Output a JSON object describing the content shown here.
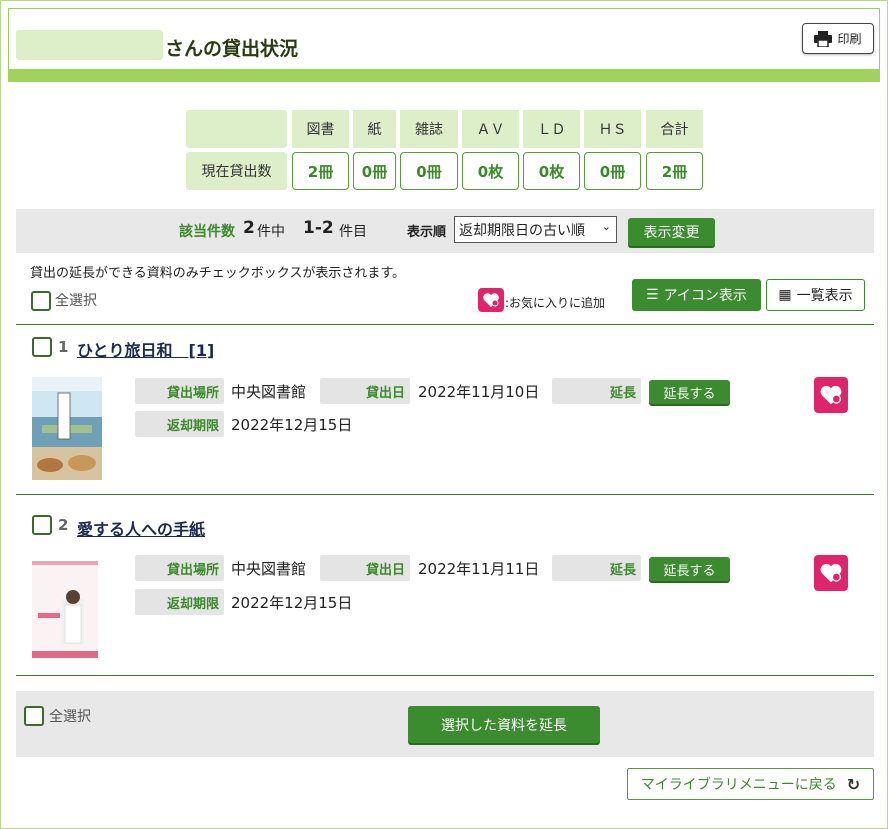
{
  "header": {
    "title_suffix": "さんの貸出状況",
    "print_label": "印刷"
  },
  "stats": {
    "headers": [
      "図書",
      "紙",
      "雑誌",
      "ＡＶ",
      "ＬＤ",
      "ＨＳ",
      "合計"
    ],
    "row_label": "現在貸出数",
    "values": [
      "2冊",
      "0冊",
      "0冊",
      "0枚",
      "0枚",
      "0冊",
      "2冊"
    ]
  },
  "result": {
    "count_label": "該当件数",
    "total": "2",
    "total_unit": "件中",
    "range": "1-2",
    "range_unit": "件目",
    "sort_label": "表示順",
    "sort_selected": "返却期限日の古い順",
    "change_button": "表示変更"
  },
  "note": "貸出の延長ができる資料のみチェックボックスが表示されます。",
  "select_all": "全選択",
  "favorite_legend": ":お気に入りに追加",
  "view_buttons": {
    "icon": "アイコン表示",
    "list": "一覧表示"
  },
  "field_labels": {
    "location": "貸出場所",
    "loan_date": "貸出日",
    "extend": "延長",
    "due": "返却期限",
    "extend_button": "延長する"
  },
  "items": [
    {
      "no": "1",
      "title": "ひとり旅日和　[1]",
      "location": "中央図書館",
      "loan_date": "2022年11月10日",
      "due": "2022年12月15日"
    },
    {
      "no": "2",
      "title": "愛する人への手紙",
      "location": "中央図書館",
      "loan_date": "2022年11月11日",
      "due": "2022年12月15日"
    }
  ],
  "bottom": {
    "extend_selected": "選択した資料を延長",
    "back": "マイライブラリメニューに戻る"
  },
  "colors": {
    "accent_green": "#3b8c2e",
    "header_bar": "#9fd35c",
    "favorite_pink": "#e0246c"
  },
  "icons": [
    "printer-icon",
    "heart-plus-icon",
    "icon-view-icon",
    "list-view-icon",
    "refresh-icon"
  ]
}
